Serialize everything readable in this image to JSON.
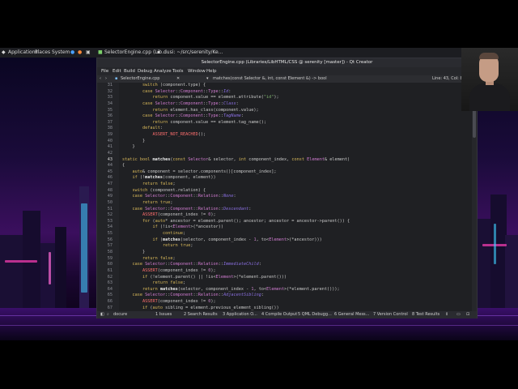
{
  "panel": {
    "applications": "Applications",
    "places": "Places",
    "system": "System",
    "task1": "SelectorEngine.cpp (Lib...",
    "task2": "dusi: ~/src/serenity/Ke..."
  },
  "window": {
    "title": "SelectorEngine.cpp (Libraries/LibHTML/CSS @ serenity [master]) - Qt Creator",
    "menu": [
      "File",
      "Edit",
      "Build",
      "Debug",
      "Analyze",
      "Tools",
      "Window",
      "Help"
    ],
    "toolbar": {
      "file": "SelectorEngine.cpp",
      "symbol": "matches(const Selector &, int, const Element &) -> bool",
      "position": "Line: 43, Col: 8"
    },
    "status": {
      "locator": "docure",
      "tabs": [
        "1 Issues",
        "2 Search Results",
        "3 Application O...",
        "4 Compile Output",
        "5 QML Debugg...",
        "6 General Mess...",
        "7 Version Control",
        "8 Test Results"
      ]
    }
  },
  "code_lines": [
    {
      "n": "31",
      "t": "        switch (component.type) {"
    },
    {
      "n": "32",
      "t": "        case Selector::Component::Type::Id:"
    },
    {
      "n": "33",
      "t": "            return component.value == element.attribute(\"id\");"
    },
    {
      "n": "34",
      "t": "        case Selector::Component::Type::Class:"
    },
    {
      "n": "35",
      "t": "            return element.has_class(component.value);"
    },
    {
      "n": "36",
      "t": "        case Selector::Component::Type::TagName:"
    },
    {
      "n": "37",
      "t": "            return component.value == element.tag_name();"
    },
    {
      "n": "38",
      "t": "        default:"
    },
    {
      "n": "39",
      "t": "            ASSERT_NOT_REACHED();"
    },
    {
      "n": "40",
      "t": "        }"
    },
    {
      "n": "41",
      "t": "    }"
    },
    {
      "n": "42",
      "t": ""
    },
    {
      "n": "43",
      "t": "static bool matches(const Selector& selector, int component_index, const Element& element)"
    },
    {
      "n": "44",
      "t": "{"
    },
    {
      "n": "45",
      "t": "    auto& component = selector.components()[component_index];"
    },
    {
      "n": "46",
      "t": "    if (!matches(component, element))"
    },
    {
      "n": "47",
      "t": "        return false;"
    },
    {
      "n": "48",
      "t": "    switch (component.relation) {"
    },
    {
      "n": "49",
      "t": "    case Selector::Component::Relation::None:"
    },
    {
      "n": "50",
      "t": "        return true;"
    },
    {
      "n": "51",
      "t": "    case Selector::Component::Relation::Descendant:"
    },
    {
      "n": "52",
      "t": "        ASSERT(component_index != 0);"
    },
    {
      "n": "53",
      "t": "        for (auto* ancestor = element.parent(); ancestor; ancestor = ancestor->parent()) {"
    },
    {
      "n": "54",
      "t": "            if (!is<Element>(*ancestor))"
    },
    {
      "n": "55",
      "t": "                continue;"
    },
    {
      "n": "56",
      "t": "            if (matches(selector, component_index - 1, to<Element>(*ancestor)))"
    },
    {
      "n": "57",
      "t": "                return true;"
    },
    {
      "n": "58",
      "t": "        }"
    },
    {
      "n": "59",
      "t": "        return false;"
    },
    {
      "n": "60",
      "t": "    case Selector::Component::Relation::ImmediateChild:"
    },
    {
      "n": "61",
      "t": "        ASSERT(component_index != 0);"
    },
    {
      "n": "62",
      "t": "        if (!element.parent() || !is<Element>(*element.parent()))"
    },
    {
      "n": "63",
      "t": "            return false;"
    },
    {
      "n": "64",
      "t": "        return matches(selector, component_index - 1, to<Element>(*element.parent()));"
    },
    {
      "n": "65",
      "t": "    case Selector::Component::Relation::AdjacentSibling:"
    },
    {
      "n": "66",
      "t": "        ASSERT(component_index != 0);"
    },
    {
      "n": "67",
      "t": "        if (auto sibling = element.previous_element_sibling())"
    }
  ],
  "icons": [
    "applications-icon",
    "firefox-icon",
    "terminal-icon",
    "qtcreator-icon"
  ],
  "colors": {
    "keyword": "#d8b85a",
    "type": "#d07cd0",
    "enum": "#8a6fe0",
    "string": "#7fb06e",
    "macro": "#ff6f6f"
  }
}
